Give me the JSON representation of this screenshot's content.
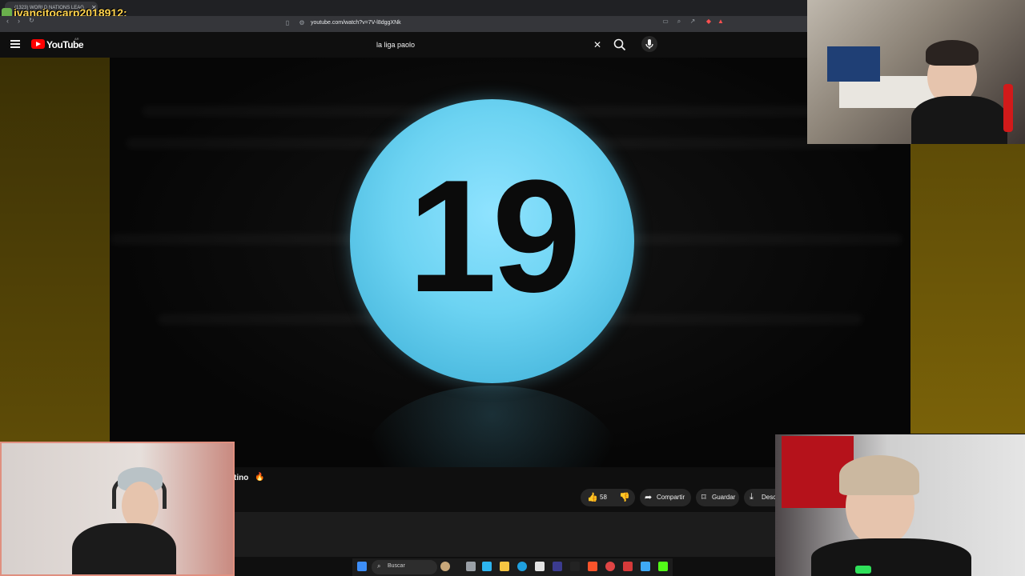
{
  "browser": {
    "tab_title": "(1323) WORLD NATIONS LEAG",
    "url": "youtube.com/watch?v=7V-l8dggXNk"
  },
  "stream_overlay": {
    "username": "ivancitocarp2018912:"
  },
  "youtube": {
    "logo_text": "YouTube",
    "country_code": "AR",
    "search_query": "la liga paolo"
  },
  "video": {
    "ball_number": "19",
    "ball_color": "#6cd3f2",
    "title_fragment": "tino"
  },
  "actions": {
    "likes": "58",
    "share_label": "Compartir",
    "save_label": "Guardar",
    "download_label": "Desc"
  },
  "taskbar": {
    "search_placeholder": "Buscar"
  }
}
